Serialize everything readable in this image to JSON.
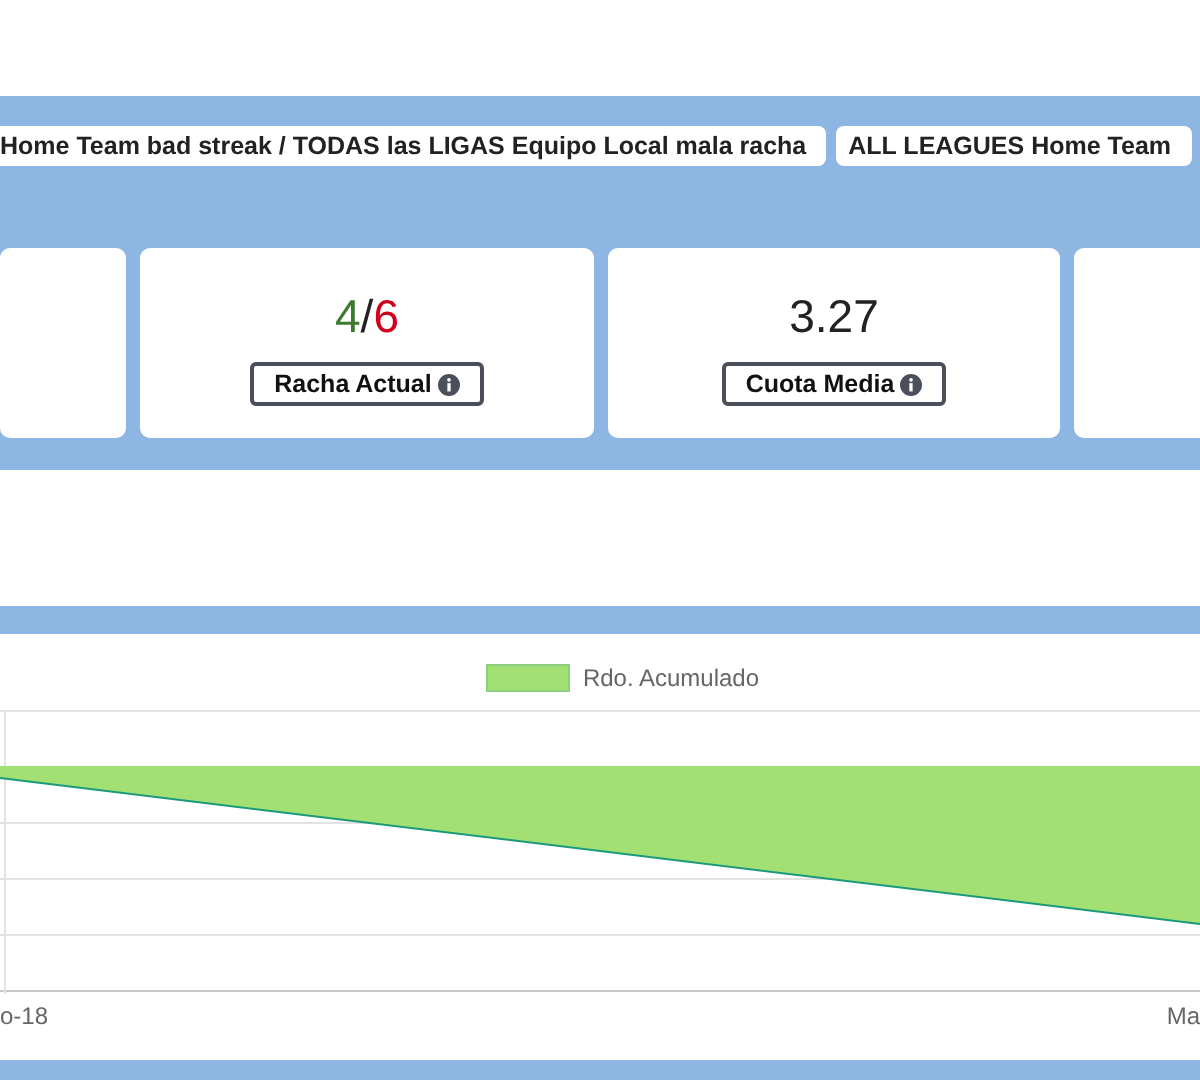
{
  "tabs": [
    {
      "label": "Home Team bad streak / TODAS las LIGAS Equipo Local mala racha",
      "selected": false
    },
    {
      "label": "ALL LEAGUES Home Team",
      "selected": false
    }
  ],
  "cards": [
    {
      "kind": "empty"
    },
    {
      "kind": "streak",
      "won": "4",
      "separator": "/",
      "lost": "6",
      "label": "Racha Actual"
    },
    {
      "kind": "value",
      "value": "3.27",
      "label": "Cuota Media"
    },
    {
      "kind": "empty"
    }
  ],
  "chart": {
    "legend": "Rdo. Acumulado",
    "x_labels": [
      "o-18",
      "Ma"
    ]
  }
}
